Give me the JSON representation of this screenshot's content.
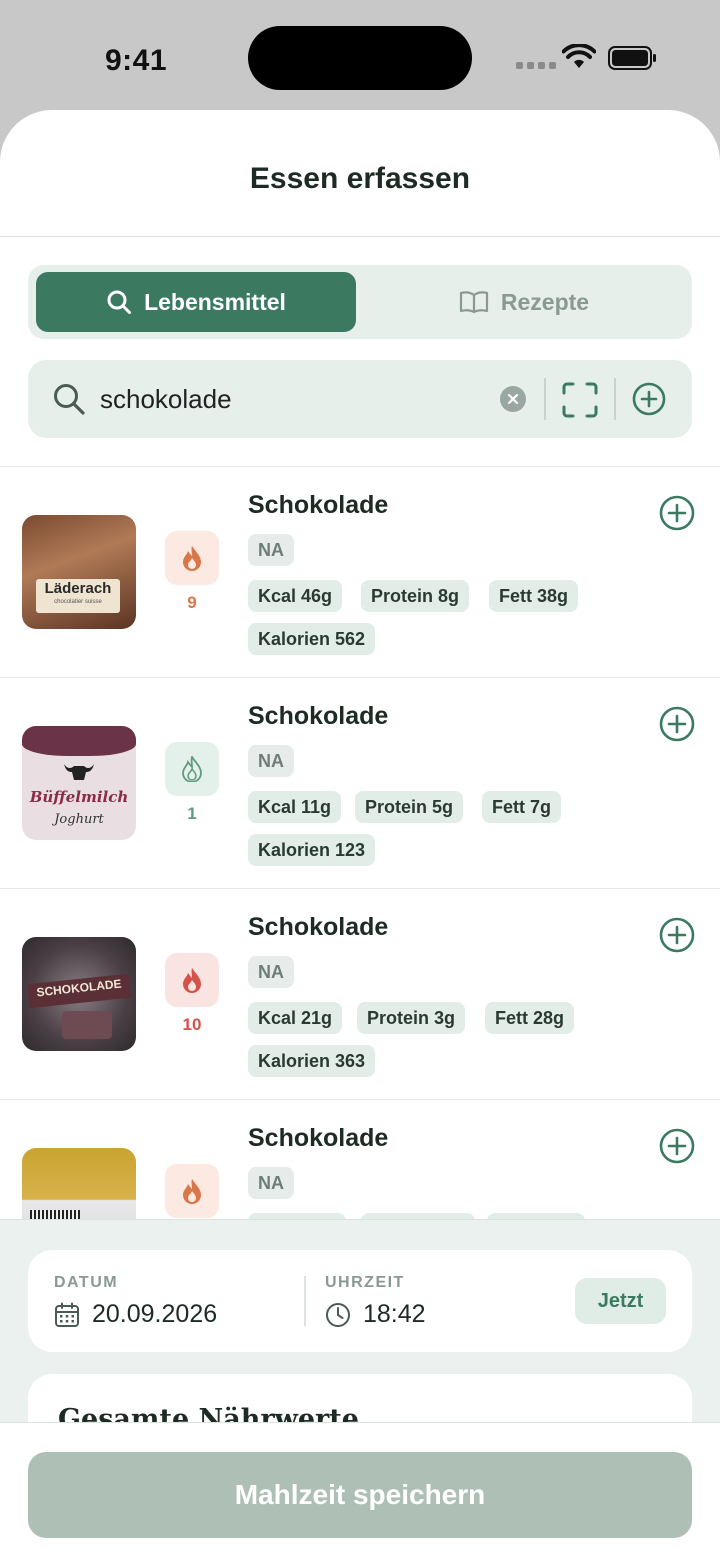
{
  "status_bar": {
    "time": "9:41"
  },
  "sheet": {
    "title": "Essen erfassen"
  },
  "segmented": {
    "active_label": "Lebensmittel",
    "inactive_label": "Rezepte"
  },
  "search": {
    "value": "schokolade",
    "placeholder": ""
  },
  "items": [
    {
      "name": "Schokolade",
      "source": "NA",
      "score": "9",
      "score_level": "medium",
      "thumb_text": "Läderach",
      "thumb_subtext": "chocolatier suisse",
      "tags": [
        "Kcal 46g",
        "Protein 8g",
        "Fett 38g",
        "Kalorien 562"
      ]
    },
    {
      "name": "Schokolade",
      "source": "NA",
      "score": "1",
      "score_level": "low",
      "thumb_text": "Büffelmilch",
      "thumb_subtext": "Joghurt",
      "tags": [
        "Kcal 11g",
        "Protein 5g",
        "Fett 7g",
        "Kalorien 123"
      ]
    },
    {
      "name": "Schokolade",
      "source": "NA",
      "score": "10",
      "score_level": "high",
      "thumb_text": "SCHOKOLADE",
      "thumb_subtext": "",
      "tags": [
        "Kcal 21g",
        "Protein 3g",
        "Fett 28g",
        "Kalorien 363"
      ]
    },
    {
      "name": "Schokolade",
      "source": "NA",
      "score": "",
      "score_level": "medium",
      "thumb_text": "",
      "thumb_subtext": "",
      "tags": []
    }
  ],
  "datetime": {
    "date_label": "DATUM",
    "date_value": "20.09.2026",
    "time_label": "UHRZEIT",
    "time_value": "18:42",
    "now_label": "Jetzt"
  },
  "totals": {
    "title": "Gesamte Nährwerte"
  },
  "save": {
    "label": "Mahlzeit speichern"
  },
  "colors": {
    "accent": "#3b7a61",
    "flame_medium": "#d9774a",
    "flame_low": "#5f9c7e",
    "flame_high": "#d4524a",
    "save_disabled": "#aec0b6"
  }
}
